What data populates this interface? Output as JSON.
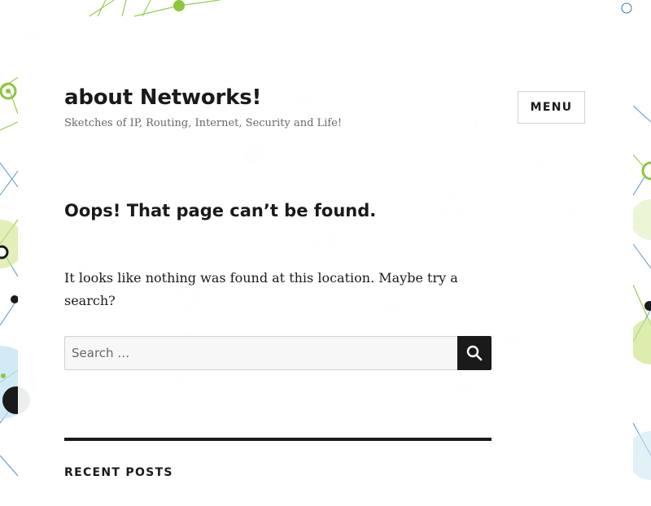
{
  "site": {
    "title": "about Networks!",
    "tagline": "Sketches of IP, Routing, Internet, Security and Life!"
  },
  "header": {
    "menu_label": "MENU"
  },
  "main": {
    "heading": "Oops! That page can’t be found.",
    "message": "It looks like nothing was found at this location. Maybe try a search?"
  },
  "search": {
    "placeholder": "Search …",
    "value": "",
    "submit_icon": "search-icon"
  },
  "sidebar": {
    "widget_title": "RECENT POSTS"
  },
  "colors": {
    "text": "#1a1a1a",
    "muted": "#686868",
    "border": "#d1d1d1",
    "accent_green": "#8cc63f",
    "accent_blue": "#2b7bb9"
  }
}
